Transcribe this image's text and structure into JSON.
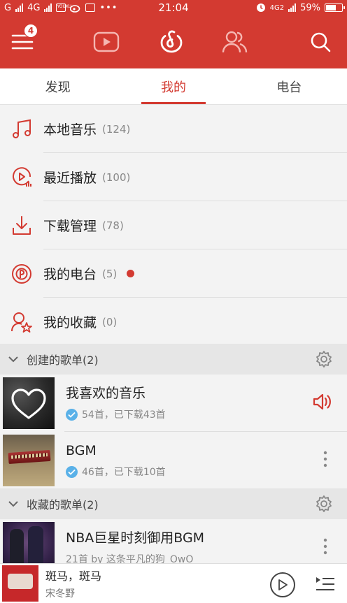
{
  "status_bar": {
    "carrier1": "G",
    "network": "4G",
    "time": "21:04",
    "network2": "4G2",
    "battery_percent": "59%",
    "battery_level": 0.59,
    "app_notif": "YOUKU"
  },
  "header": {
    "menu_badge": "4",
    "active_icon": "netease-music-logo",
    "icons": [
      "menu-icon",
      "video-play-icon",
      "netease-music-logo",
      "friends-icon",
      "search-icon"
    ]
  },
  "tabs": [
    {
      "label": "发现",
      "active": false
    },
    {
      "label": "我的",
      "active": true
    },
    {
      "label": "电台",
      "active": false
    }
  ],
  "menu": [
    {
      "icon": "music-note-icon",
      "label": "本地音乐",
      "count": "(124)"
    },
    {
      "icon": "recent-play-icon",
      "label": "最近播放",
      "count": "(100)"
    },
    {
      "icon": "download-icon",
      "label": "下载管理",
      "count": "(78)"
    },
    {
      "icon": "radio-icon",
      "label": "我的电台",
      "count": "(5)",
      "dot": true
    },
    {
      "icon": "favorites-icon",
      "label": "我的收藏",
      "count": "(0)"
    }
  ],
  "created_section": {
    "title": "创建的歌单(2)"
  },
  "created_playlists": [
    {
      "title": "我喜欢的音乐",
      "subtitle": "54首，已下载43首",
      "trailing": "speaker-icon"
    },
    {
      "title": "BGM",
      "subtitle": "46首，已下载10首",
      "trailing": "more-icon"
    }
  ],
  "collected_section": {
    "title": "收藏的歌单(2)"
  },
  "collected_playlists": [
    {
      "title": "NBA巨星时刻御用BGM",
      "subtitle": "21首 by 这条平凡的狗_OwO",
      "trailing": "more-icon"
    }
  ],
  "player": {
    "title": "斑马，斑马",
    "artist": "宋冬野"
  },
  "colors": {
    "accent": "#d33a31",
    "check": "#5ab1e8"
  }
}
